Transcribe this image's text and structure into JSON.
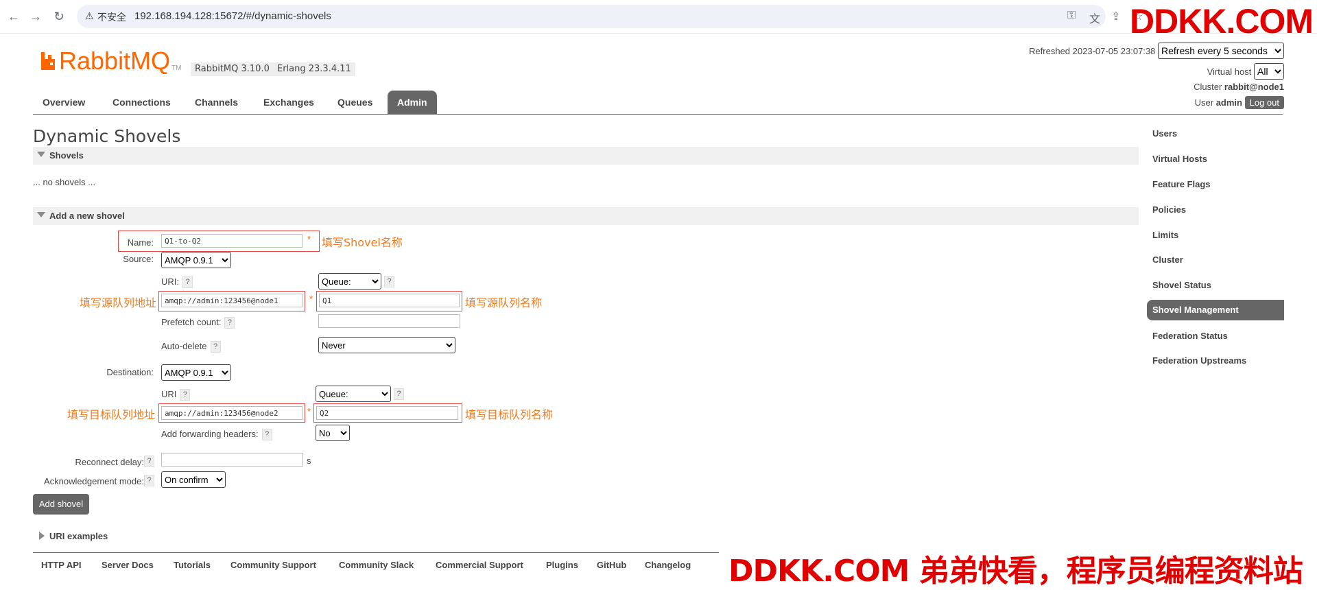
{
  "browser": {
    "insecure_label": "不安全",
    "url": "192.168.194.128:15672/#/dynamic-shovels",
    "watermark": "DDKK.COM"
  },
  "header": {
    "logo_text": "RabbitMQ",
    "logo_tm": "TM",
    "version_rabbitmq": "RabbitMQ 3.10.0",
    "version_erlang": "Erlang 23.3.4.11",
    "refreshed_label": "Refreshed 2023-07-05 23:07:38",
    "refresh_option": "Refresh every 5 seconds",
    "vhost_label": "Virtual host",
    "vhost_option": "All",
    "cluster_label": "Cluster",
    "cluster_value": "rabbit@node1",
    "user_label": "User",
    "user_value": "admin",
    "logout_label": "Log out"
  },
  "tabs": [
    "Overview",
    "Connections",
    "Channels",
    "Exchanges",
    "Queues",
    "Admin"
  ],
  "page": {
    "title": "Dynamic Shovels",
    "shovels_section": "Shovels",
    "no_shovels": "... no shovels ...",
    "add_section": "Add a new shovel",
    "uri_examples": "URI examples"
  },
  "form": {
    "name_label": "Name:",
    "name_value": "Q1-to-Q2",
    "source_label": "Source:",
    "source_protocol": "AMQP 0.9.1",
    "uri_label": "URI:",
    "source_uri": "amqp://admin:123456@node1",
    "source_type": "Queue:",
    "source_queue": "Q1",
    "prefetch_label": "Prefetch count:",
    "autodelete_label": "Auto-delete",
    "autodelete_value": "Never",
    "destination_label": "Destination:",
    "dest_protocol": "AMQP 0.9.1",
    "dest_uri_label": "URI",
    "dest_uri": "amqp://admin:123456@node2",
    "dest_type": "Queue:",
    "dest_queue": "Q2",
    "fwd_headers_label": "Add forwarding headers:",
    "fwd_headers_value": "No",
    "reconnect_label": "Reconnect delay:",
    "reconnect_unit": "s",
    "ack_label": "Acknowledgement mode:",
    "ack_value": "On confirm",
    "submit_label": "Add shovel",
    "help": "?",
    "required": "*"
  },
  "annotations": {
    "name": "填写Shovel名称",
    "source_uri": "填写源队列地址",
    "source_queue": "填写源队列名称",
    "dest_uri": "填写目标队列地址",
    "dest_queue": "填写目标队列名称"
  },
  "sidebar": [
    "Users",
    "Virtual Hosts",
    "Feature Flags",
    "Policies",
    "Limits",
    "Cluster",
    "Shovel Status",
    "Shovel Management",
    "Federation Status",
    "Federation Upstreams"
  ],
  "footer": [
    "HTTP API",
    "Server Docs",
    "Tutorials",
    "Community Support",
    "Community Slack",
    "Commercial Support",
    "Plugins",
    "GitHub",
    "Changelog"
  ],
  "footer_watermark": "DDKK.COM 弟弟快看，程序员编程资料站",
  "colors": {
    "accent": "#ff6600",
    "nav_active": "#666666",
    "annotation": "#f07a1b",
    "highlight_box": "#e54545",
    "watermark": "#e00000"
  }
}
